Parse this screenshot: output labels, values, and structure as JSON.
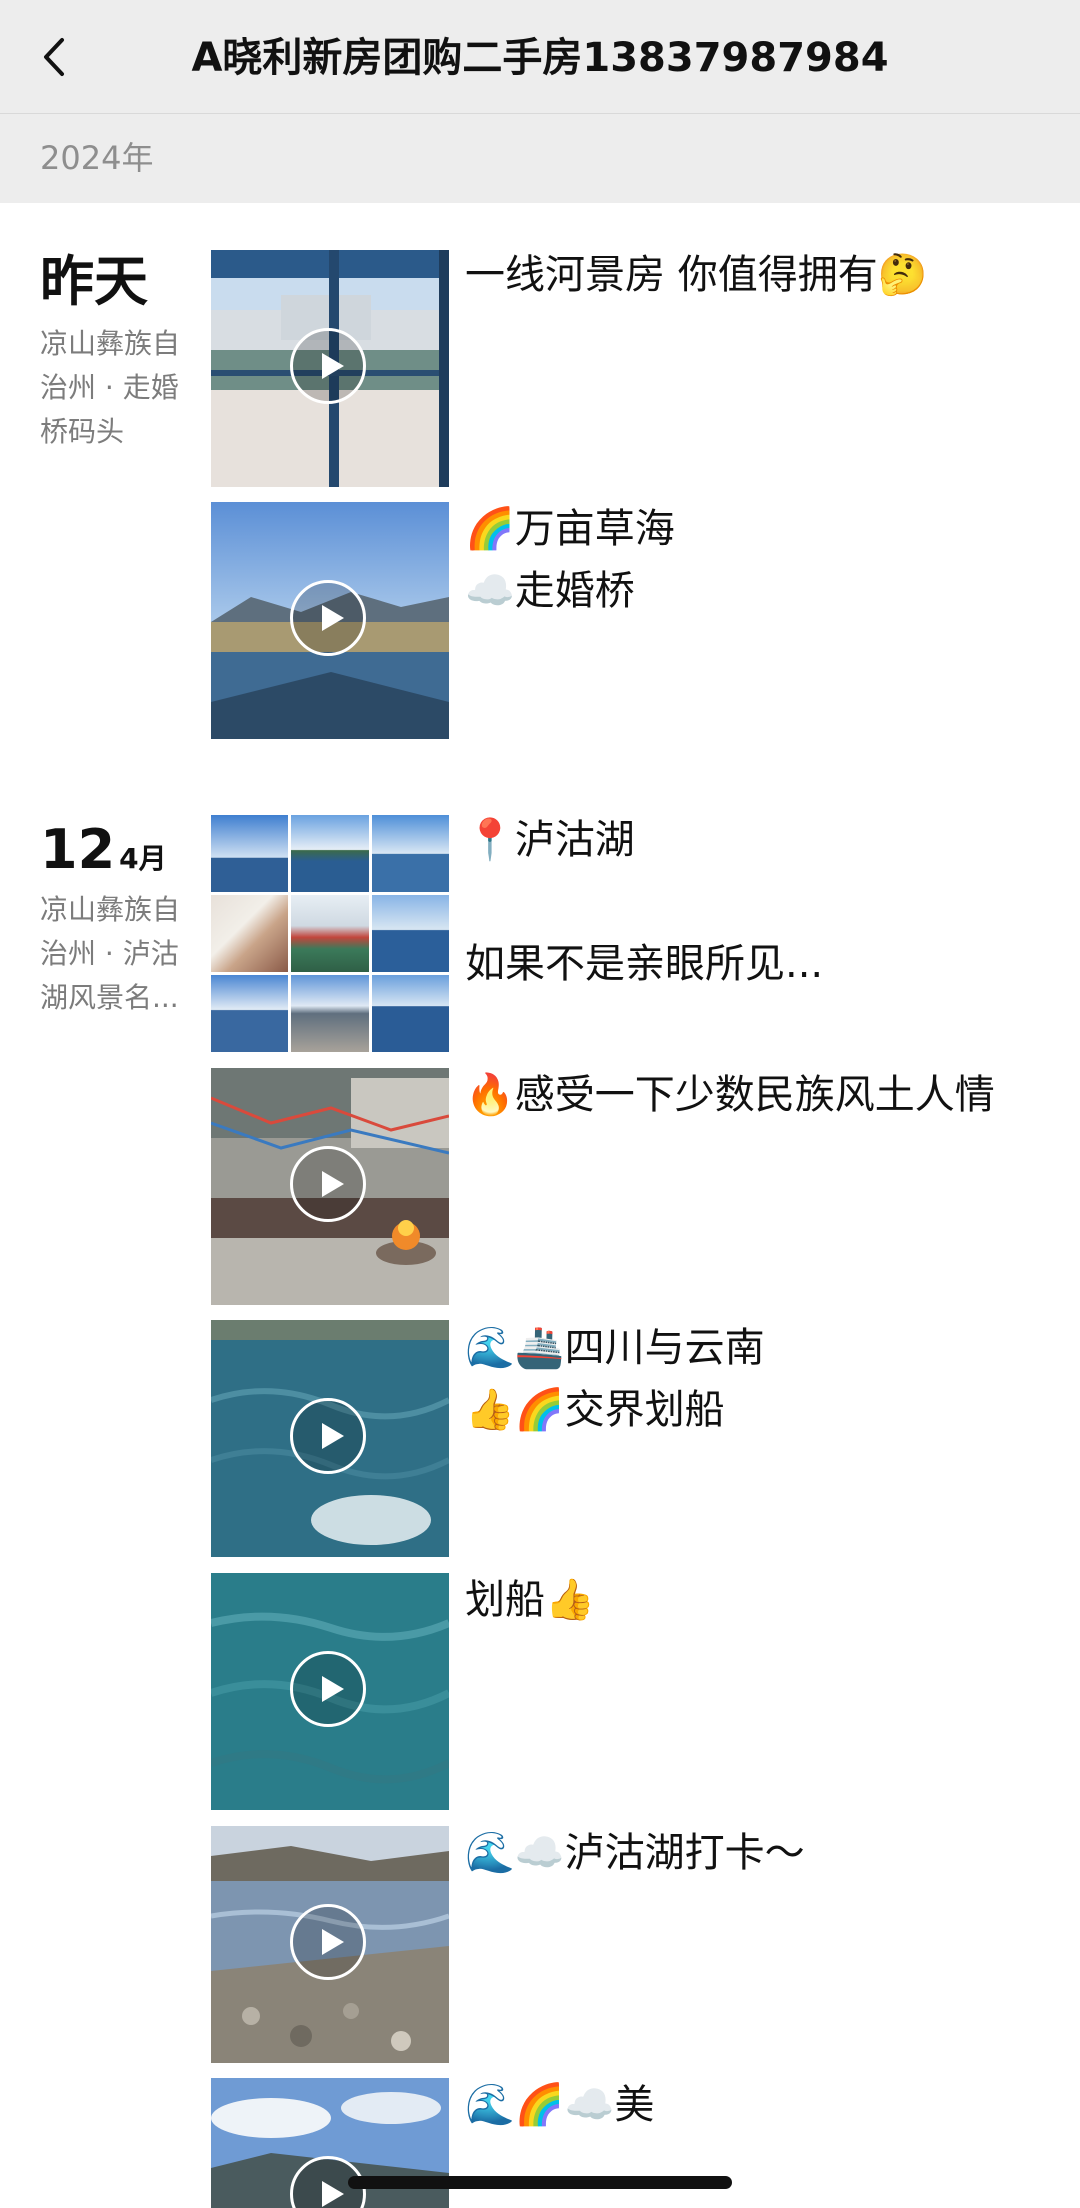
{
  "header": {
    "title": "A晓利新房团购二手房13837987984"
  },
  "year_label": "2024年",
  "groups": [
    {
      "date_label": "昨天",
      "location": "凉山彝族自治州 · 走婚桥码头",
      "posts": [
        {
          "caption": "一线河景房 你值得拥有🤔"
        },
        {
          "caption": "🌈万亩草海\n☁️走婚桥"
        }
      ]
    },
    {
      "day": "12",
      "month": "4月",
      "location": "凉山彝族自治州 · 泸沽湖风景名...",
      "posts": [
        {
          "caption": "📍泸沽湖\n\n如果不是亲眼所见..."
        },
        {
          "caption": "🔥感受一下少数民族风土人情"
        },
        {
          "caption": "🌊🚢四川与云南\n👍🌈交界划船"
        },
        {
          "caption": "划船👍"
        },
        {
          "caption": "🌊☁️泸沽湖打卡～"
        },
        {
          "caption": "🌊🌈☁️美"
        }
      ]
    }
  ],
  "icons": {
    "back": "chevron-left-icon",
    "play": "play-icon"
  }
}
